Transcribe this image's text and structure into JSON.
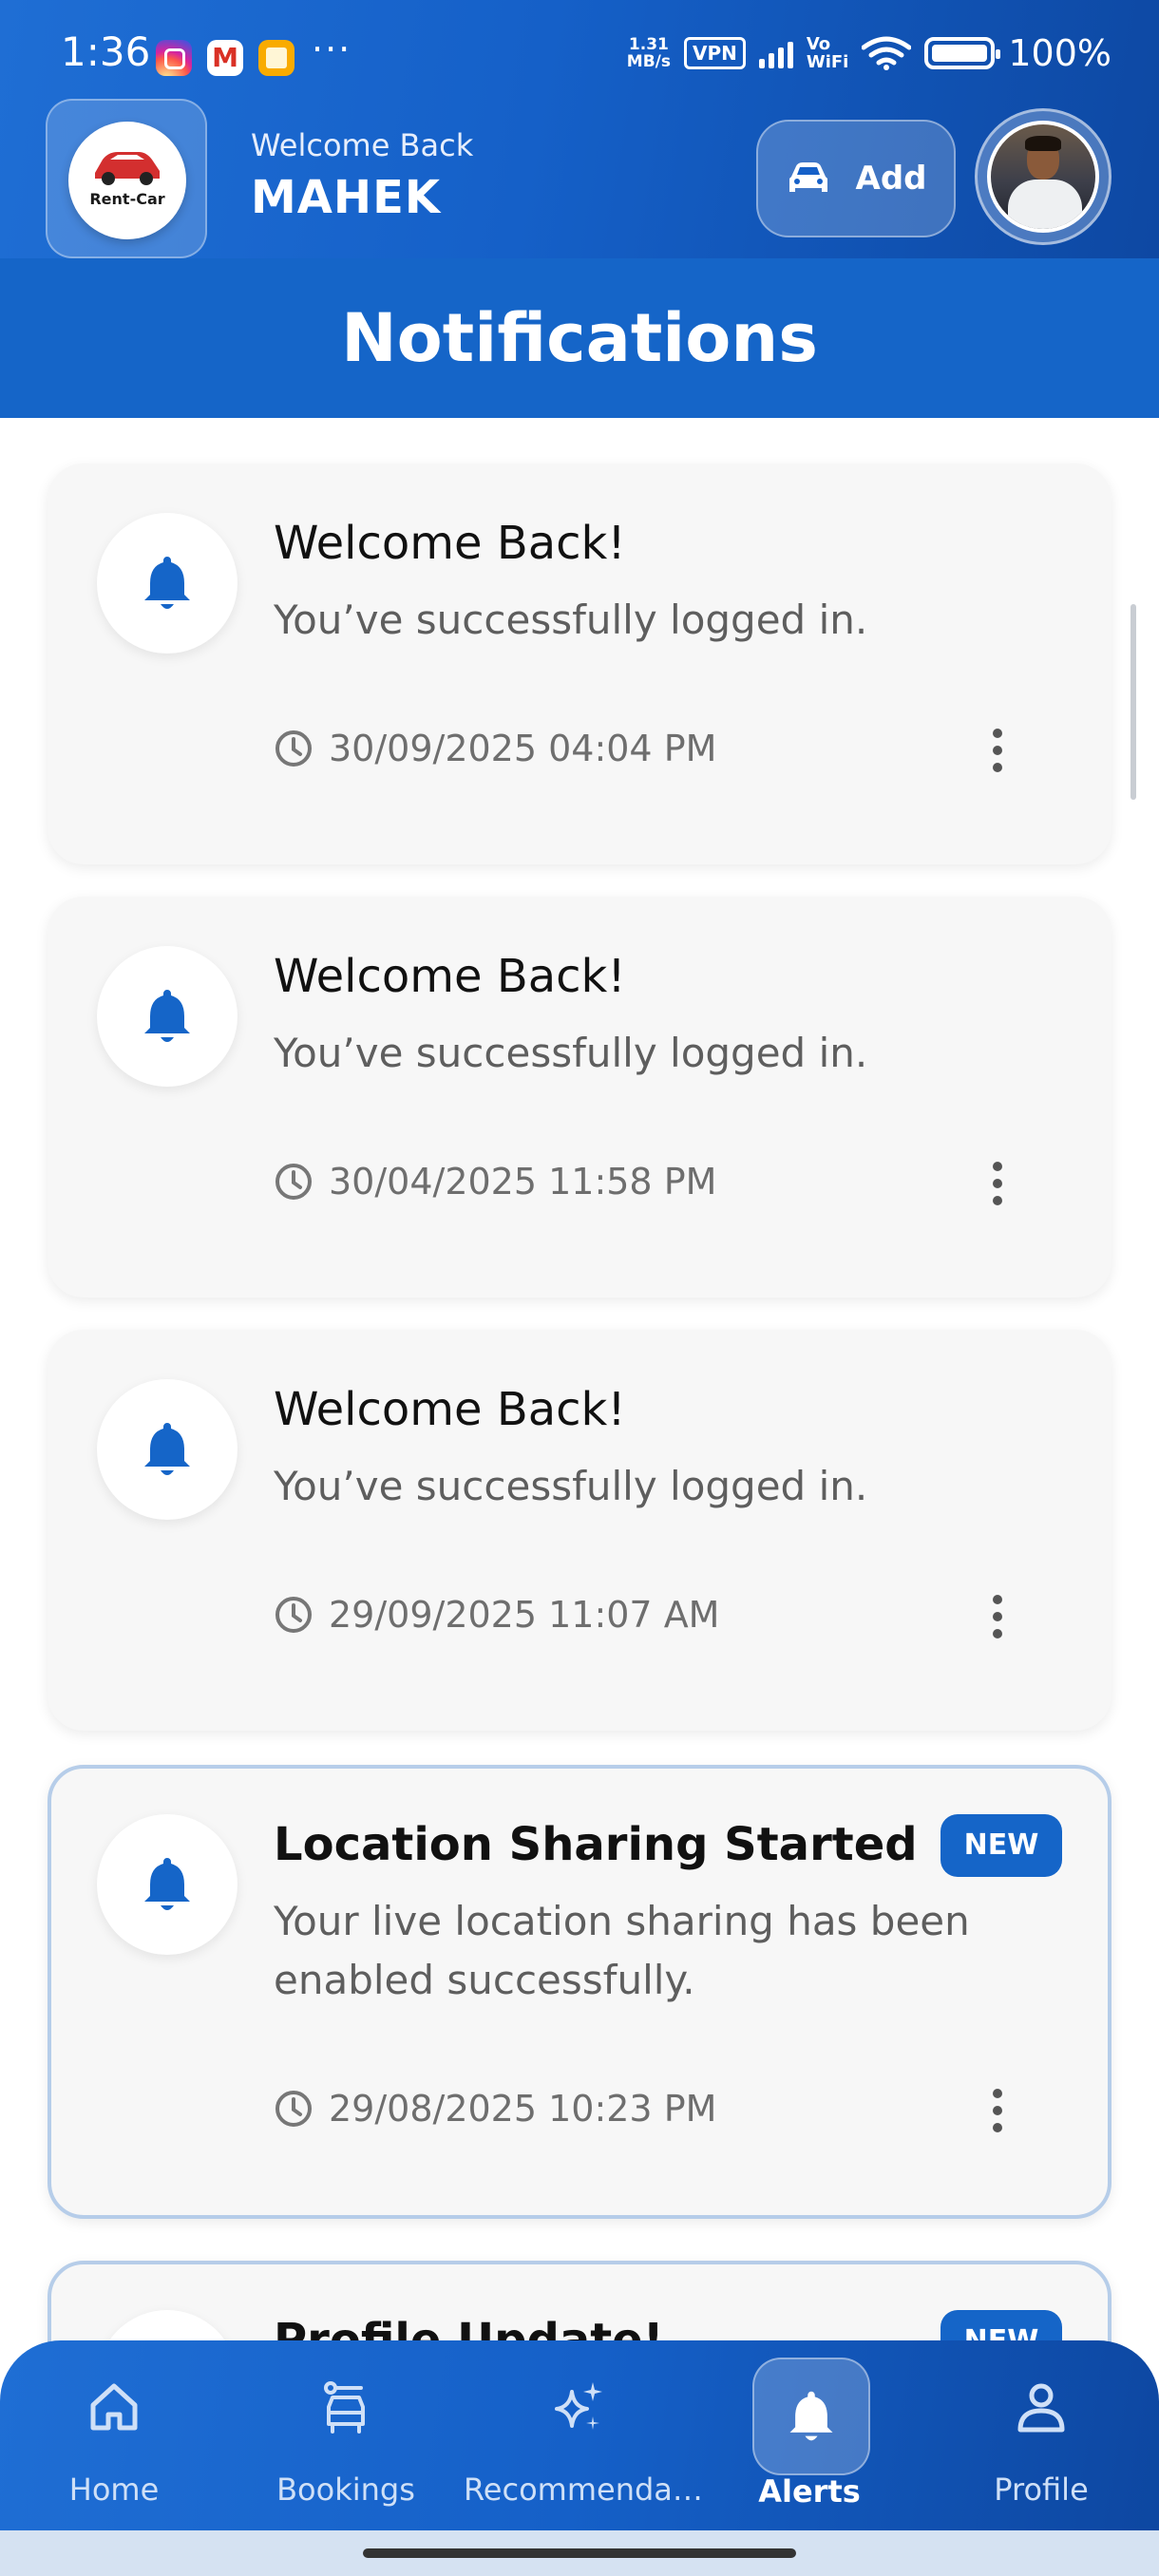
{
  "status_bar": {
    "time": "1:36",
    "more": "···",
    "net_speed_value": "1.31",
    "net_speed_unit": "MB/s",
    "vpn": "VPN",
    "vowifi_top": "Vo",
    "vowifi_bottom": "WiFi",
    "battery": "100%"
  },
  "header": {
    "logo_text": "Rent-Car",
    "welcome_sub": "Welcome Back",
    "user_name": "MAHEK",
    "add_label": "Add",
    "page_title": "Notifications"
  },
  "notifications": [
    {
      "title": "Welcome Back!",
      "message": "You’ve successfully logged in.",
      "time": "30/09/2025 04:04 PM",
      "is_new": false
    },
    {
      "title": "Welcome Back!",
      "message": "You’ve successfully logged in.",
      "time": "30/04/2025 11:58 PM",
      "is_new": false
    },
    {
      "title": "Welcome Back!",
      "message": "You’ve successfully logged in.",
      "time": "29/09/2025 11:07 AM",
      "is_new": false
    },
    {
      "title": "Location Sharing Started",
      "message": "Your live location sharing has been enabled successfully.",
      "time": "29/08/2025 10:23 PM",
      "is_new": true,
      "badge": "NEW"
    },
    {
      "title": "Profile Update!",
      "is_new": true,
      "badge": "NEW"
    }
  ],
  "nav": {
    "items": [
      {
        "label": "Home",
        "icon": "home-icon"
      },
      {
        "label": "Bookings",
        "icon": "car-seat-icon"
      },
      {
        "label": "Recommenda…",
        "icon": "sparkle-icon"
      },
      {
        "label": "Alerts",
        "icon": "bell-icon",
        "active": true
      },
      {
        "label": "Profile",
        "icon": "person-icon"
      }
    ]
  },
  "colors": {
    "primary": "#1565c8",
    "primary_dark": "#0d47a1",
    "card_bg": "#f7f7f7",
    "new_border": "#b6cde9"
  }
}
